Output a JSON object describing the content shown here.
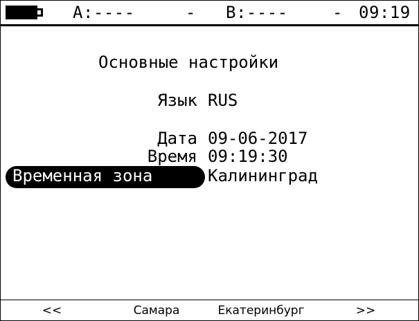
{
  "status_bar": {
    "battery_icon": "battery-full-icon",
    "channel_a": "A:----",
    "dash1": "-",
    "channel_b": "B:----",
    "dash2": "-",
    "clock": "09:19"
  },
  "screen": {
    "title": "Основные настройки",
    "settings": {
      "language": {
        "label": "Язык",
        "value": "RUS"
      },
      "date": {
        "label": "Дата",
        "value": "09-06-2017"
      },
      "time": {
        "label": "Время",
        "value": "09:19:30"
      },
      "timezone": {
        "label": "Временная зона",
        "value": "Калининград",
        "selected": true
      }
    }
  },
  "softkeys": {
    "prev": "<<",
    "option1": "Самара",
    "option2": "Екатеринбург",
    "next": ">>"
  },
  "colors": {
    "foreground": "#000000",
    "background": "#ffffff",
    "selection_text": "#ffffff"
  }
}
